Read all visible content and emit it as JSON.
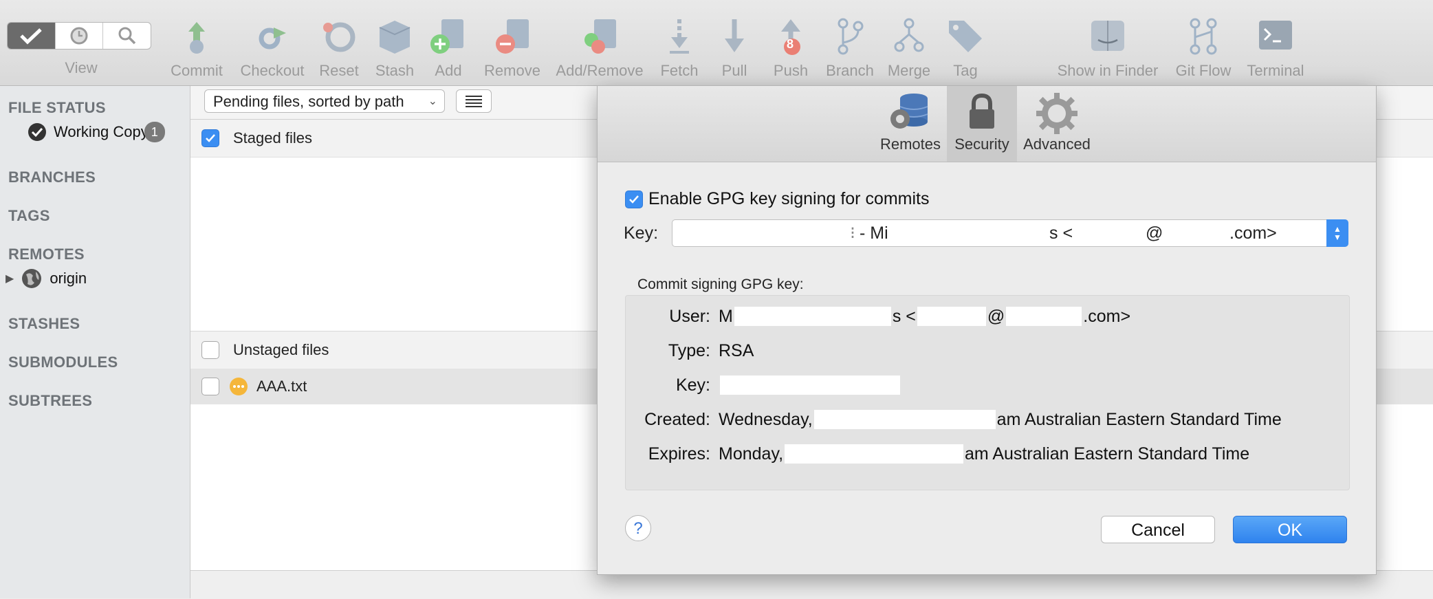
{
  "toolbar": {
    "view_label": "View",
    "items": [
      {
        "label": "Commit",
        "icon": "commit-icon"
      },
      {
        "label": "Checkout",
        "icon": "checkout-icon"
      },
      {
        "label": "Reset",
        "icon": "reset-icon"
      },
      {
        "label": "Stash",
        "icon": "stash-icon"
      },
      {
        "label": "Add",
        "icon": "add-icon"
      },
      {
        "label": "Remove",
        "icon": "remove-icon"
      },
      {
        "label": "Add/Remove",
        "icon": "add-remove-icon"
      },
      {
        "label": "Fetch",
        "icon": "fetch-icon"
      },
      {
        "label": "Pull",
        "icon": "pull-icon"
      },
      {
        "label": "Push",
        "icon": "push-icon",
        "badge": "8"
      },
      {
        "label": "Branch",
        "icon": "branch-icon"
      },
      {
        "label": "Merge",
        "icon": "merge-icon"
      },
      {
        "label": "Tag",
        "icon": "tag-icon"
      },
      {
        "label": "Show in Finder",
        "icon": "finder-icon"
      },
      {
        "label": "Git Flow",
        "icon": "git-flow-icon"
      },
      {
        "label": "Terminal",
        "icon": "terminal-icon"
      }
    ]
  },
  "sidebar": {
    "file_status": "FILE STATUS",
    "working_copy": "Working Copy",
    "working_copy_count": "1",
    "branches": "BRANCHES",
    "tags": "TAGS",
    "remotes": "REMOTES",
    "origin": "origin",
    "stashes": "STASHES",
    "submodules": "SUBMODULES",
    "subtrees": "SUBTREES"
  },
  "main": {
    "sort_dropdown": "Pending files, sorted by path",
    "staged_label": "Staged files",
    "unstaged_label": "Unstaged files",
    "files": [
      {
        "name": "AAA.txt"
      }
    ]
  },
  "dialog": {
    "tabs": [
      {
        "label": "Remotes",
        "icon": "database-gear-icon",
        "selected": false
      },
      {
        "label": "Security",
        "icon": "lock-icon",
        "selected": true
      },
      {
        "label": "Advanced",
        "icon": "gear-icon",
        "selected": false
      }
    ],
    "enable_gpg_label": "Enable GPG key signing for commits",
    "enable_gpg_checked": true,
    "key_label": "Key:",
    "key_value_parts": [
      " - Mi",
      "s <",
      "@",
      ".com>"
    ],
    "group_label": "Commit signing GPG key:",
    "user_label": "User:",
    "user_value_parts": [
      "M",
      "s <",
      "@",
      ".com>"
    ],
    "type_label": "Type:",
    "type_value": "RSA",
    "key_info_label": "Key:",
    "created_label": "Created:",
    "created_value_parts": [
      "Wednesday,",
      "am Australian Eastern Standard Time"
    ],
    "expires_label": "Expires:",
    "expires_value_parts": [
      "Monday,",
      "am Australian Eastern Standard Time"
    ],
    "help_label": "?",
    "cancel_label": "Cancel",
    "ok_label": "OK"
  },
  "colors": {
    "accent": "#3b8ef2",
    "toolbar_label": "#9b9b9b",
    "sidebar_head": "#6e7378"
  }
}
